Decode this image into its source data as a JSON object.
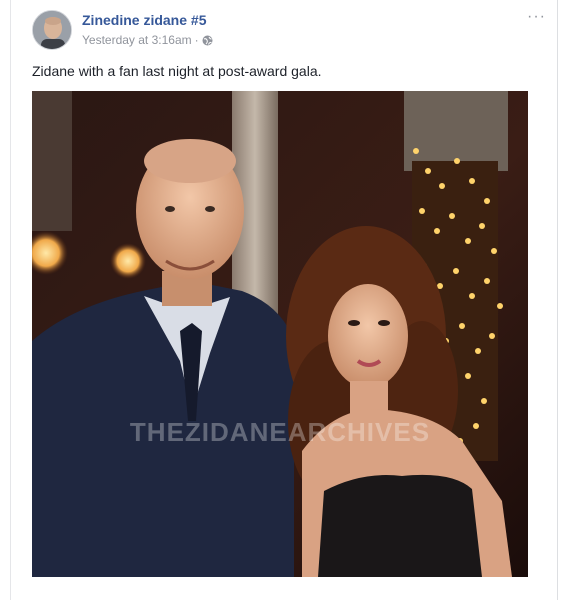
{
  "post": {
    "author": "Zinedine zidane #5",
    "timestamp": "Yesterday at 3:16am",
    "separator": "·",
    "privacy_icon": "globe-icon",
    "options_icon": "more-options-icon",
    "options_label": "···",
    "text": "Zidane with a fan last night at post-award gala.",
    "photo": {
      "watermark": "THEZIDANEARCHIVES"
    }
  },
  "colors": {
    "author_link": "#365899",
    "meta_text": "#90949c",
    "body_text": "#1d2129"
  }
}
